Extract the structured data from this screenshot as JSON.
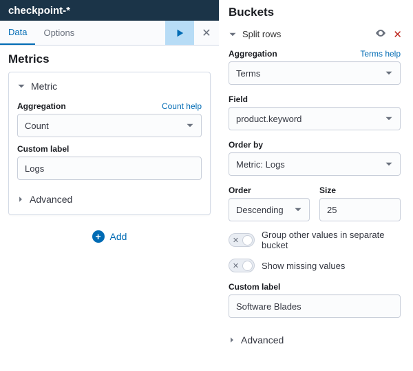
{
  "topbar": {
    "title": "checkpoint-*"
  },
  "tabs": {
    "data": "Data",
    "options": "Options"
  },
  "metrics": {
    "title": "Metrics",
    "card": {
      "header": "Metric",
      "agg_label": "Aggregation",
      "agg_help": "Count help",
      "agg_value": "Count",
      "custom_label_label": "Custom label",
      "custom_label_value": "Logs",
      "advanced": "Advanced"
    },
    "add": "Add"
  },
  "buckets": {
    "title": "Buckets",
    "split_rows": "Split rows",
    "agg_label": "Aggregation",
    "agg_help": "Terms help",
    "agg_value": "Terms",
    "field_label": "Field",
    "field_value": "product.keyword",
    "orderby_label": "Order by",
    "orderby_value": "Metric: Logs",
    "order_label": "Order",
    "order_value": "Descending",
    "size_label": "Size",
    "size_value": "25",
    "group_other": "Group other values in separate bucket",
    "show_missing": "Show missing values",
    "custom_label_label": "Custom label",
    "custom_label_value": "Software Blades",
    "advanced": "Advanced"
  }
}
